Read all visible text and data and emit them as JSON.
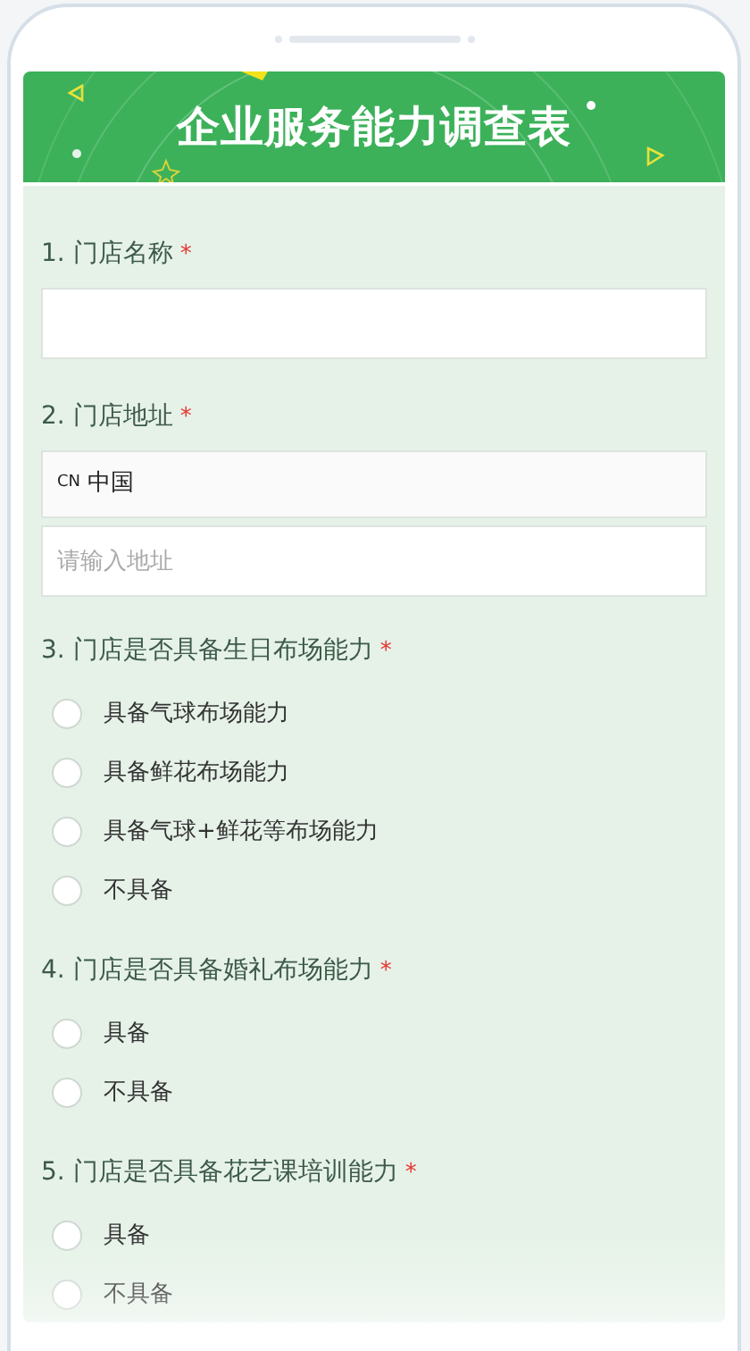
{
  "title": "企业服务能力调查表",
  "questions": [
    {
      "number": "1.",
      "label": "门店名称",
      "required_mark": "*",
      "kind": "text"
    },
    {
      "number": "2.",
      "label": "门店地址",
      "required_mark": "*",
      "kind": "address",
      "country_code": "CN",
      "country": "中国",
      "placeholder": "请输入地址"
    },
    {
      "number": "3.",
      "label": "门店是否具备生日布场能力",
      "required_mark": "*",
      "kind": "radio",
      "options": [
        {
          "label": "具备气球布场能力",
          "selected": false
        },
        {
          "label": "具备鲜花布场能力",
          "selected": false
        },
        {
          "label": "具备气球+鲜花等布场能力",
          "selected": false
        },
        {
          "label": "不具备",
          "selected": false
        }
      ]
    },
    {
      "number": "4.",
      "label": "门店是否具备婚礼布场能力",
      "required_mark": "*",
      "kind": "radio",
      "options": [
        {
          "label": "具备",
          "selected": false
        },
        {
          "label": "不具备",
          "selected": false
        }
      ]
    },
    {
      "number": "5.",
      "label": "门店是否具备花艺课培训能力",
      "required_mark": "*",
      "kind": "radio",
      "options": [
        {
          "label": "具备",
          "selected": false
        },
        {
          "label": "不具备",
          "selected": false
        }
      ]
    }
  ]
}
